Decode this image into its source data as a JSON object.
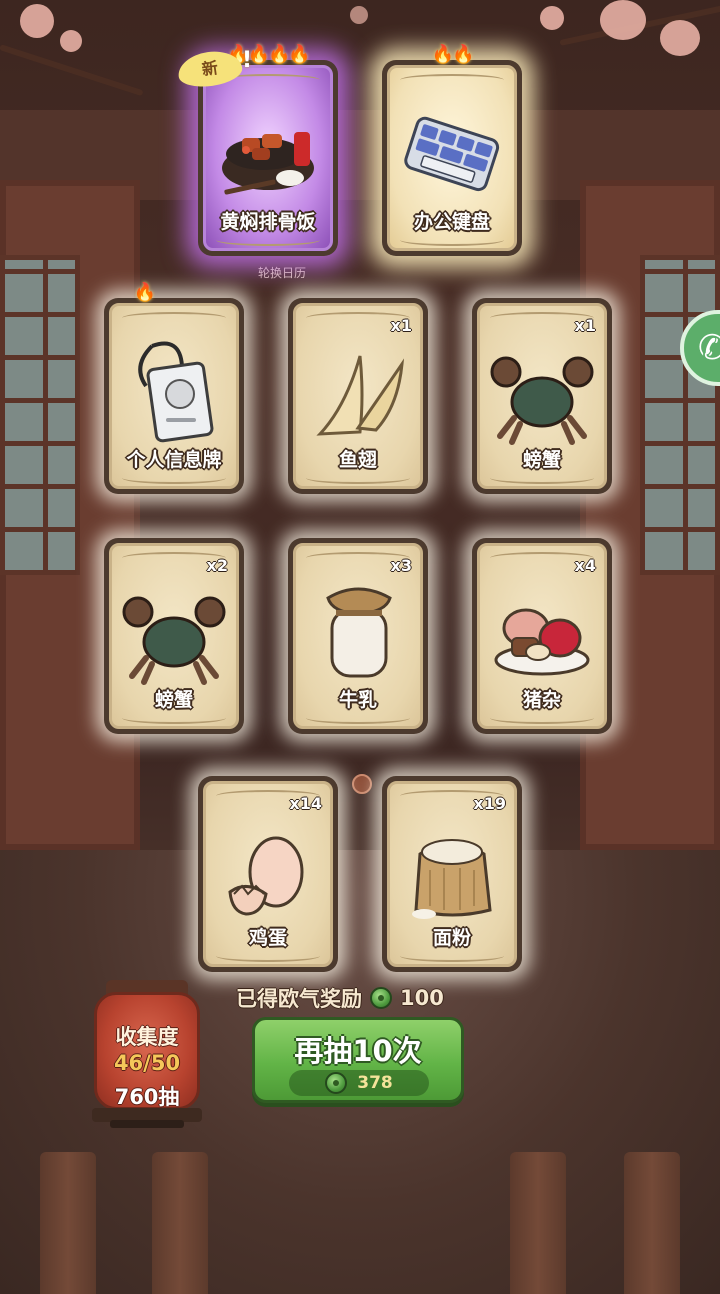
{
  "cards": [
    {
      "id": "braised-ribs",
      "name": "黄焖排骨饭",
      "count": "",
      "rarity": "purple",
      "flames": 4,
      "is_new": true,
      "new_label": "新",
      "icon": "braised-pork-ribs-rice-icon"
    },
    {
      "id": "keyboard",
      "name": "办公键盘",
      "count": "",
      "rarity": "gold",
      "flames": 2,
      "is_new": false,
      "icon": "office-keyboard-icon"
    },
    {
      "id": "name-tag",
      "name": "个人信息牌",
      "count": "",
      "rarity": "normal",
      "flames": 1,
      "is_new": false,
      "icon": "name-tag-icon"
    },
    {
      "id": "shark-fin",
      "name": "鱼翅",
      "count": "x1",
      "rarity": "normal",
      "flames": 0,
      "is_new": false,
      "icon": "shark-fin-icon"
    },
    {
      "id": "crab-1",
      "name": "螃蟹",
      "count": "x1",
      "rarity": "normal",
      "flames": 0,
      "is_new": false,
      "icon": "crab-icon"
    },
    {
      "id": "crab-2",
      "name": "螃蟹",
      "count": "x2",
      "rarity": "normal",
      "flames": 0,
      "is_new": false,
      "icon": "crab-icon"
    },
    {
      "id": "milk",
      "name": "牛乳",
      "count": "x3",
      "rarity": "normal",
      "flames": 0,
      "is_new": false,
      "icon": "milk-jar-icon"
    },
    {
      "id": "offal",
      "name": "猪杂",
      "count": "x4",
      "rarity": "normal",
      "flames": 0,
      "is_new": false,
      "icon": "pork-offal-icon"
    },
    {
      "id": "egg",
      "name": "鸡蛋",
      "count": "x14",
      "rarity": "normal",
      "flames": 0,
      "is_new": false,
      "icon": "egg-icon"
    },
    {
      "id": "flour",
      "name": "面粉",
      "count": "x19",
      "rarity": "normal",
      "flames": 0,
      "is_new": false,
      "icon": "flour-sack-icon"
    }
  ],
  "sub_caption": "轮换日历",
  "reward": {
    "label": "已得欧气奖励",
    "amount": "100",
    "icon": "jade-coin-icon"
  },
  "draw_button": {
    "label": "再抽10次",
    "cost": "378",
    "icon": "jade-coin-icon"
  },
  "collection": {
    "title": "收集度",
    "progress": "46/50",
    "pulls": "760抽"
  },
  "colors": {
    "draw_button": "#62b447",
    "purple_glow": "#cd78ff",
    "gold_glow": "#fff0be",
    "lantern": "#b8432f"
  }
}
